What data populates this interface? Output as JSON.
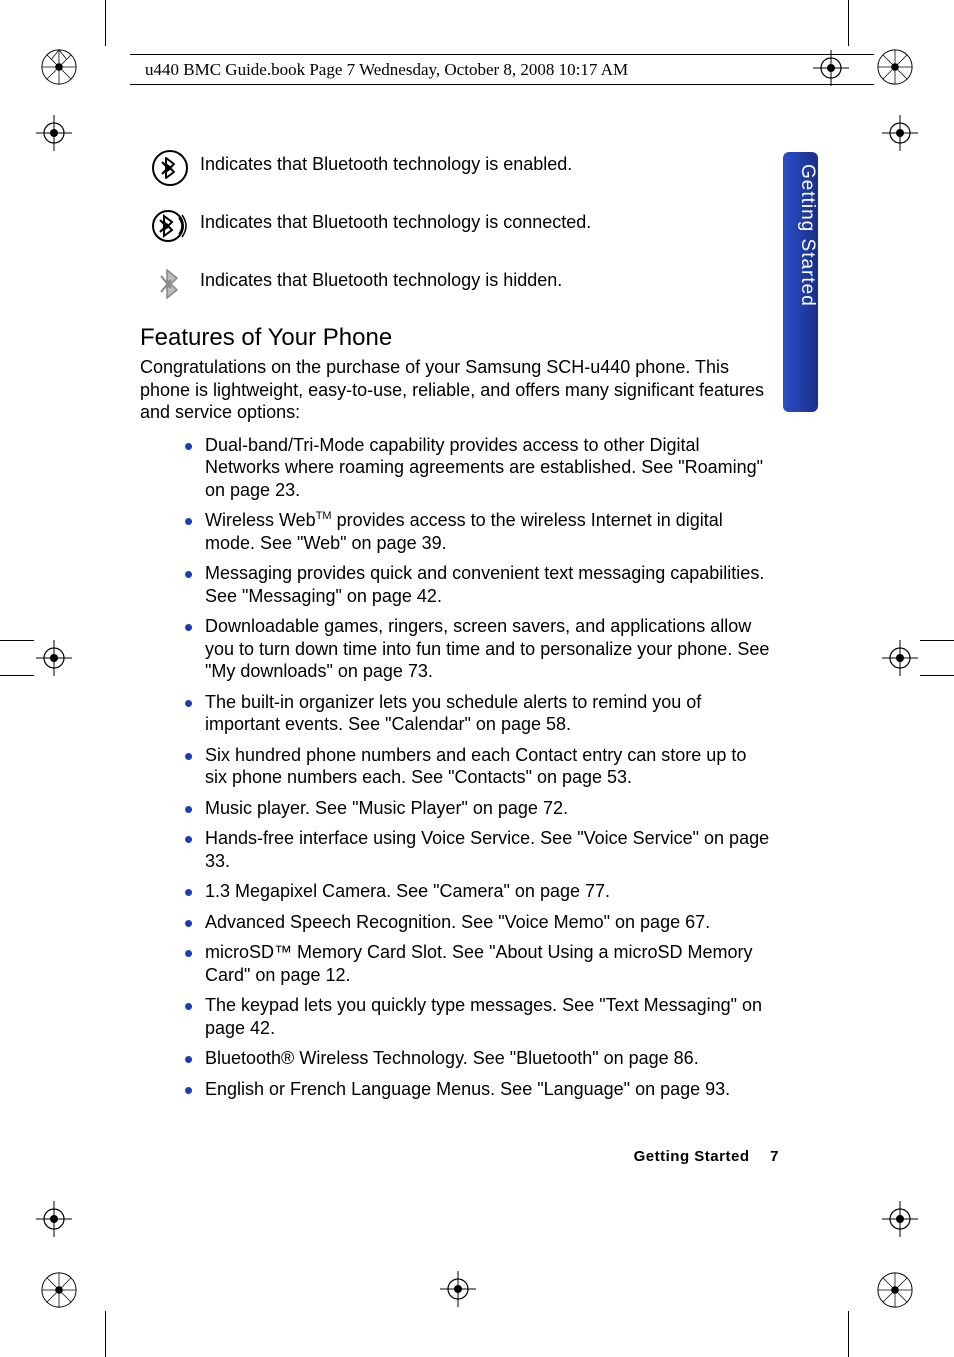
{
  "header": {
    "text": "u440 BMC Guide.book  Page 7  Wednesday, October 8, 2008  10:17 AM"
  },
  "side_tab": {
    "label": "Getting Started"
  },
  "bluetooth_indicators": [
    {
      "text": "Indicates that Bluetooth technology is enabled."
    },
    {
      "text": "Indicates that Bluetooth technology is connected."
    },
    {
      "text": "Indicates that Bluetooth technology is hidden."
    }
  ],
  "section": {
    "heading": "Features of Your Phone",
    "intro": "Congratulations on the purchase of your Samsung SCH-u440 phone. This phone is lightweight, easy-to-use, reliable, and offers many significant features and service options:"
  },
  "features": [
    "Dual-band/Tri-Mode capability provides access to other Digital Networks where roaming agreements are established. See \"Roaming\" on page 23.",
    "Wireless WebTM provides access to the wireless Internet in digital mode. See \"Web\" on page 39.",
    "Messaging provides quick and convenient text messaging capabilities. See \"Messaging\" on page 42.",
    "Downloadable games, ringers, screen savers, and applications allow you to turn down time into fun time and to personalize your phone. See \"My downloads\" on page 73.",
    "The built-in organizer lets you schedule alerts to remind you of important events. See \"Calendar\" on page 58.",
    "Six hundred phone numbers and each Contact entry can store up to six phone numbers each. See \"Contacts\" on page 53.",
    "Music player. See \"Music Player\" on page 72.",
    "Hands-free interface using Voice Service. See \"Voice Service\" on page 33.",
    "1.3 Megapixel Camera. See \"Camera\" on page 77.",
    "Advanced Speech Recognition. See \"Voice Memo\" on page 67.",
    "microSD™ Memory Card Slot. See \"About Using a microSD Memory Card\" on page 12.",
    "The keypad lets you quickly type messages. See \"Text Messaging\" on page 42.",
    "Bluetooth® Wireless Technology. See \"Bluetooth\" on page 86.",
    "English or French Language Menus. See \"Language\" on page 93."
  ],
  "footer": {
    "section": "Getting Started",
    "page": "7"
  }
}
